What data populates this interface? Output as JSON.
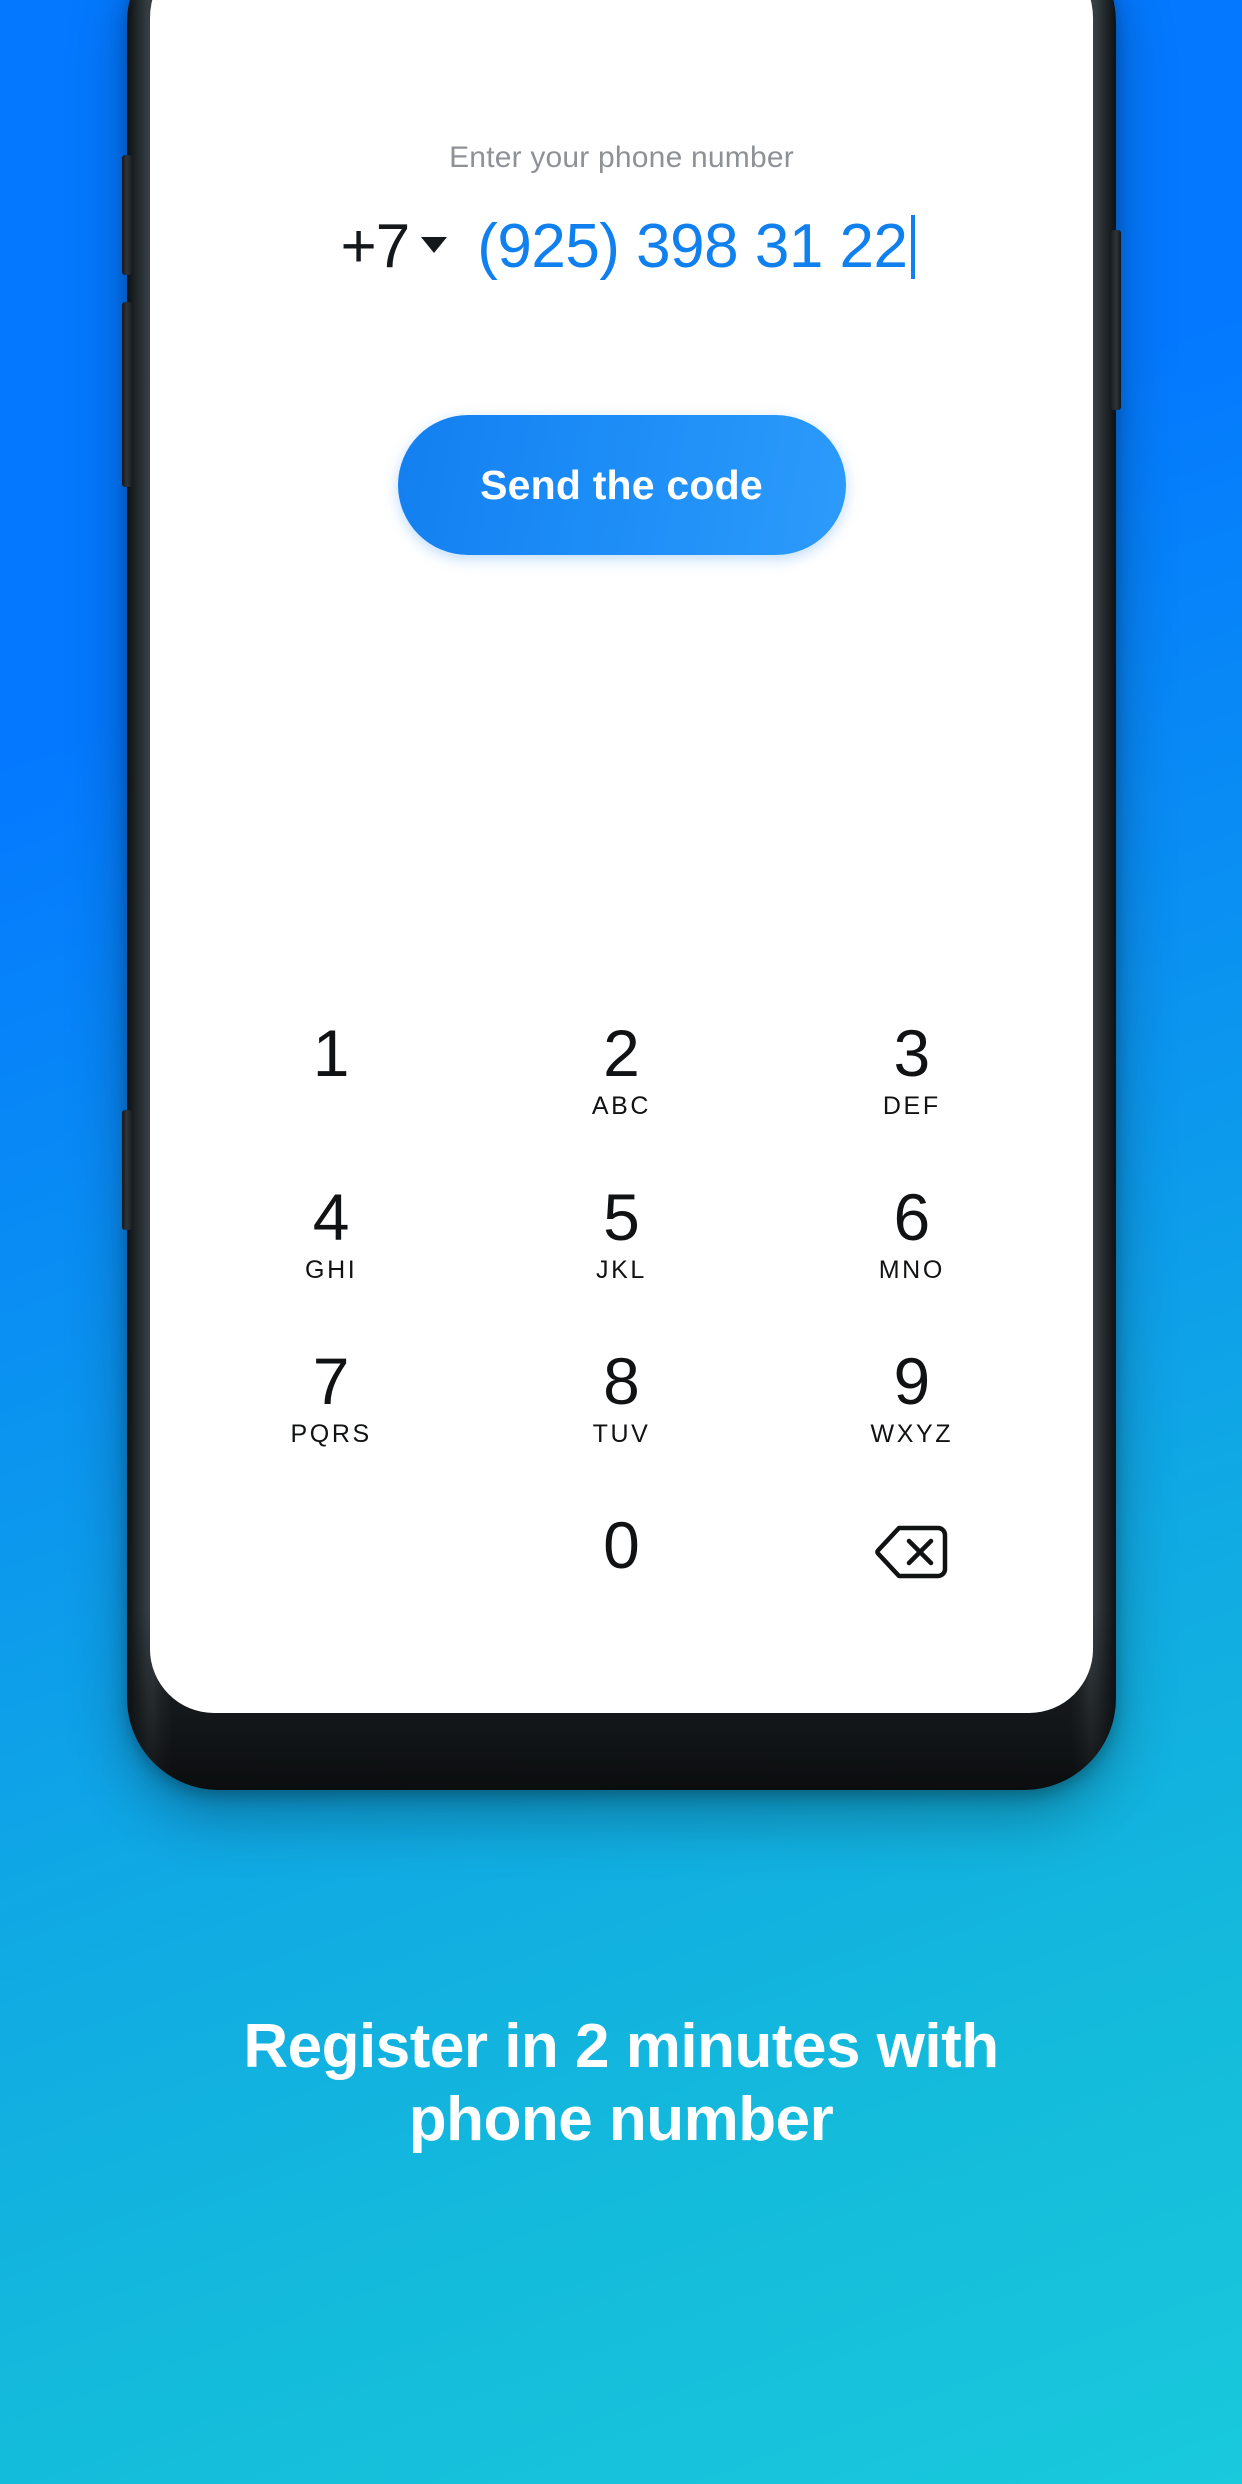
{
  "background": {
    "gradient_from": "#0479ff",
    "gradient_to": "#19c9dc"
  },
  "phone_screen": {
    "hint_label": "Enter your phone number",
    "country_code": "+7",
    "country_code_dropdown_icon": "chevron-down-icon",
    "phone_number": "(925) 398 31 22",
    "text_cursor_visible": true,
    "send_button_label": "Send the code",
    "accent_color": "#1180ef",
    "hint_color": "#8e9297"
  },
  "keypad": {
    "rows": [
      [
        {
          "digit": "1",
          "letters": ""
        },
        {
          "digit": "2",
          "letters": "ABC"
        },
        {
          "digit": "3",
          "letters": "DEF"
        }
      ],
      [
        {
          "digit": "4",
          "letters": "GHI"
        },
        {
          "digit": "5",
          "letters": "JKL"
        },
        {
          "digit": "6",
          "letters": "MNO"
        }
      ],
      [
        {
          "digit": "7",
          "letters": "PQRS"
        },
        {
          "digit": "8",
          "letters": "TUV"
        },
        {
          "digit": "9",
          "letters": "WXYZ"
        }
      ]
    ],
    "bottom_row": {
      "zero": "0",
      "backspace_icon": "backspace-icon"
    }
  },
  "caption": {
    "line1": "Register in 2 minutes with",
    "line2": "phone number",
    "color": "#ffffff"
  }
}
